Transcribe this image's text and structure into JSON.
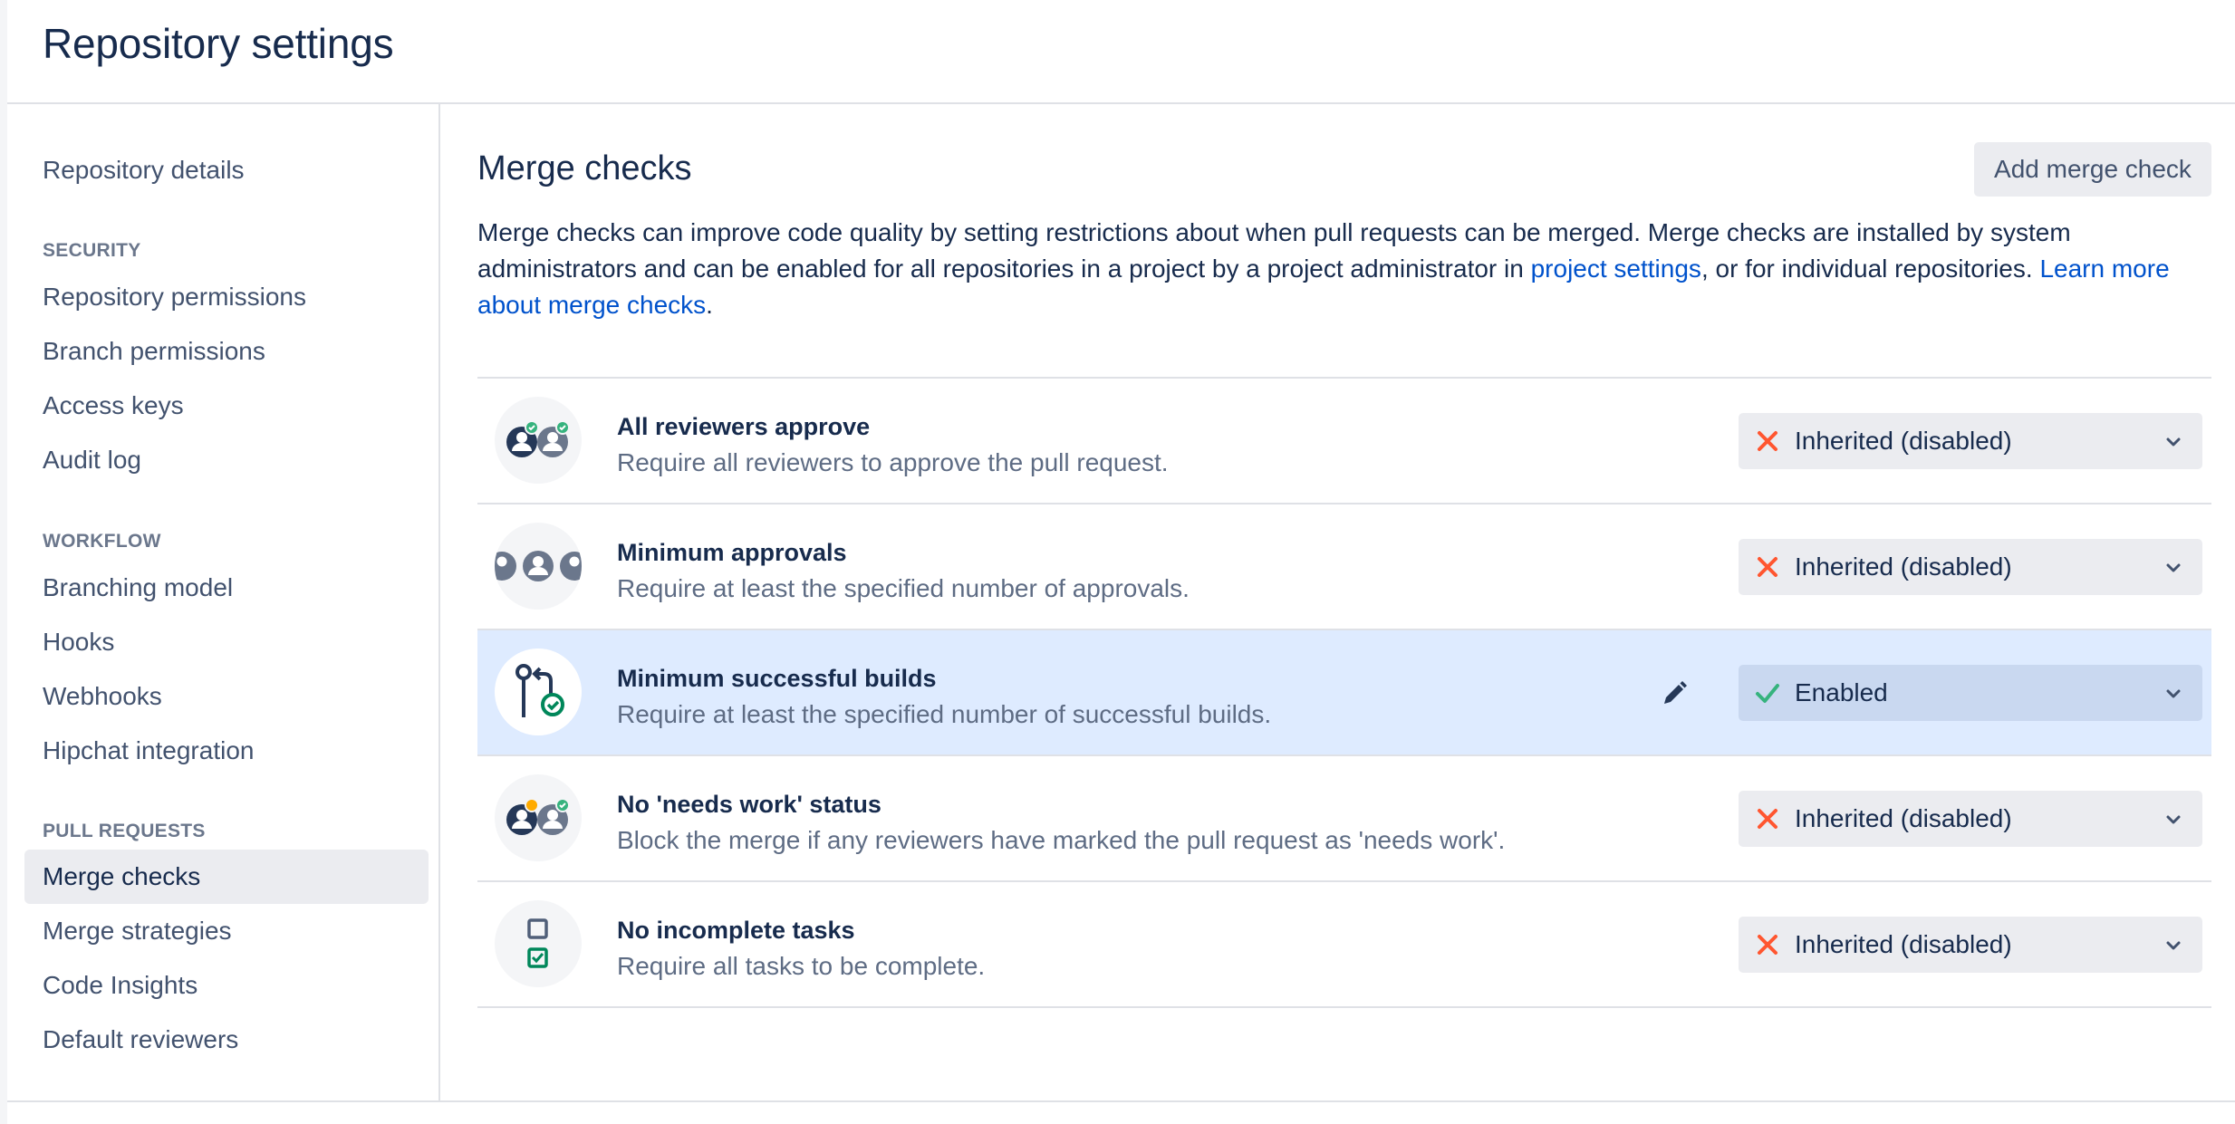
{
  "page": {
    "title": "Repository settings"
  },
  "sidebar": {
    "top_item": "Repository details",
    "sections": [
      {
        "heading": "SECURITY",
        "items": [
          "Repository permissions",
          "Branch permissions",
          "Access keys",
          "Audit log"
        ]
      },
      {
        "heading": "WORKFLOW",
        "items": [
          "Branching model",
          "Hooks",
          "Webhooks",
          "Hipchat integration"
        ]
      },
      {
        "heading": "PULL REQUESTS",
        "items": [
          "Merge checks",
          "Merge strategies",
          "Code Insights",
          "Default reviewers"
        ]
      }
    ],
    "active_item": "Merge checks"
  },
  "main": {
    "section_title": "Merge checks",
    "add_button_label": "Add merge check",
    "intro": {
      "text_before": "Merge checks can improve code quality by setting restrictions about when pull requests can be merged. Merge checks are installed by system administrators and can be enabled for all repositories in a project by a project administrator in ",
      "link_project_settings": "project settings",
      "text_middle": ", or for individual repositories. ",
      "link_learn_more": "Learn more about merge checks",
      "text_after": "."
    },
    "checks": [
      {
        "name": "All reviewers approve",
        "description": "Require all reviewers to approve the pull request.",
        "status": "Inherited (disabled)",
        "icon": "reviewers-approved-icon"
      },
      {
        "name": "Minimum approvals",
        "description": "Require at least the specified number of approvals.",
        "status": "Inherited (disabled)",
        "icon": "approvals-group-icon"
      },
      {
        "name": "Minimum successful builds",
        "description": "Require at least the specified number of successful builds.",
        "status": "Enabled",
        "icon": "successful-build-icon"
      },
      {
        "name": "No 'needs work' status",
        "description": "Block the merge if any reviewers have marked the pull request as 'needs work'.",
        "status": "Inherited (disabled)",
        "icon": "needs-work-reviewers-icon"
      },
      {
        "name": "No incomplete tasks",
        "description": "Require all tasks to be complete.",
        "status": "Inherited (disabled)",
        "icon": "tasks-checklist-icon"
      }
    ]
  },
  "colors": {
    "link": "#0052cc",
    "highlight_row": "#deebff",
    "enabled_check": "#36b37e",
    "disabled_cross": "#ff5630",
    "heading_text": "#172b4d"
  }
}
